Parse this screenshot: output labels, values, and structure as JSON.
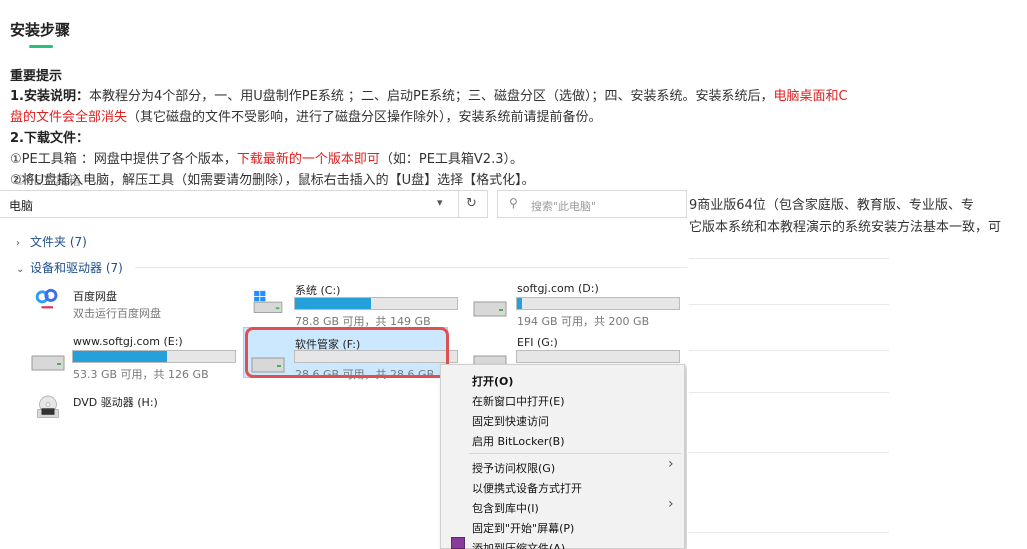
{
  "article": {
    "title": "安装步骤",
    "important_label": "重要提示",
    "p1_label": "1.安装说明：",
    "p1_text_a": "本教程分为4个部分，一、用U盘制作PE系统 ；二、启动PE系统；三、磁盘分区（选做）；四、安装系统。安装系统后，",
    "p1_red_a": "电脑桌面和C",
    "p1_red_b": "盘的文件会全部消失",
    "p1_text_b": "（其它磁盘的文件不受影响，进行了磁盘分区操作除外），安装系统前请提前备份。",
    "p2_label": "2.下载文件：",
    "p2_text_a": "①PE工具箱 ：网盘中提供了各个版本，",
    "p2_red": "下载最新的一个版本即可",
    "p2_text_b": "（如：PE工具箱V2.3）。",
    "overlap_a": "②将U盘插入电脑，解压工具（如需要请勿删除），鼠标右击插入的【U盘】选择【格式化】。",
    "overlap_b": "①PE工具箱",
    "right_line1": "9商业版64位（包含家庭版、教育版、专业版、专",
    "right_line2": "它版本系统和本教程演示的系统安装方法基本一致，可"
  },
  "explorer": {
    "address": "电脑",
    "search_placeholder": "搜索\"此电脑\"",
    "folders_group": "文件夹 (7)",
    "devices_group": "设备和驱动器 (7)",
    "drives": {
      "baidu": {
        "name": "百度网盘",
        "sub": "双击运行百度网盘"
      },
      "c": {
        "name": "系统 (C:)",
        "sub": "78.8 GB 可用，共 149 GB",
        "fill": 0.47
      },
      "d": {
        "name": "softgj.com (D:)",
        "sub": "194 GB 可用，共 200 GB",
        "fill": 0.03
      },
      "e": {
        "name": "www.softgj.com (E:)",
        "sub": "53.3 GB 可用，共 126 GB",
        "fill": 0.58
      },
      "f": {
        "name": "软件管家 (F:)",
        "sub": "28.6 GB 可用，共 28.6 GB",
        "fill": 0.0
      },
      "g": {
        "name": "EFI (G:)",
        "sub": "",
        "fill": 0.0
      },
      "h": {
        "name": "DVD 驱动器 (H:)",
        "badge": "DVD"
      }
    }
  },
  "context_menu": {
    "items": [
      "打开(O)",
      "在新窗口中打开(E)",
      "固定到快速访问",
      "启用 BitLocker(B)",
      "授予访问权限(G)",
      "以便携式设备方式打开",
      "包含到库中(I)",
      "固定到\"开始\"屏幕(P)",
      "添加到压缩文件(A)..."
    ]
  },
  "colors": {
    "accent": "#2bbf7d",
    "red": "#e02020",
    "link": "#1e4e8c",
    "fill": "#26a0da"
  }
}
